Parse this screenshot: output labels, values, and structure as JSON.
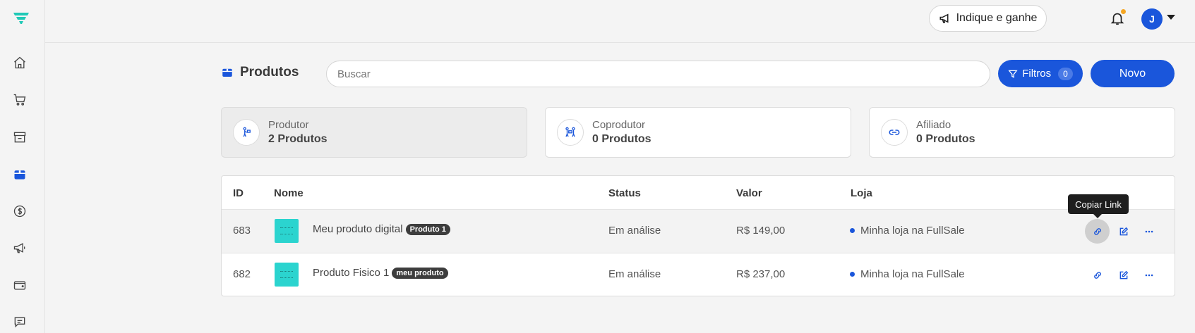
{
  "topbar": {
    "refer_label": "Indique e ganhe",
    "avatar_initial": "J"
  },
  "sidebar": {
    "items": [
      {
        "icon": "home-icon"
      },
      {
        "icon": "cart-icon"
      },
      {
        "icon": "store-icon"
      },
      {
        "icon": "box-icon",
        "active": true
      },
      {
        "icon": "dollar-icon"
      },
      {
        "icon": "megaphone-icon"
      },
      {
        "icon": "wallet-icon"
      },
      {
        "icon": "chat-icon"
      }
    ]
  },
  "header": {
    "title": "Produtos",
    "search_placeholder": "Buscar",
    "filter_label": "Filtros",
    "filter_count": "0",
    "new_label": "Novo"
  },
  "cards": [
    {
      "label": "Produtor",
      "count": "2 Produtos",
      "active": true
    },
    {
      "label": "Coprodutor",
      "count": "0 Produtos",
      "active": false
    },
    {
      "label": "Afiliado",
      "count": "0 Produtos",
      "active": false
    }
  ],
  "table": {
    "headers": {
      "id": "ID",
      "name": "Nome",
      "status": "Status",
      "value": "Valor",
      "store": "Loja"
    },
    "rows": [
      {
        "id": "683",
        "name": "Meu produto digital",
        "tag": "Produto 1",
        "status": "Em análise",
        "value": "R$ 149,00",
        "store": "Minha loja na FullSale"
      },
      {
        "id": "682",
        "name": "Produto Fisico 1",
        "tag": "meu produto",
        "status": "Em análise",
        "value": "R$ 237,00",
        "store": "Minha loja na FullSale"
      }
    ]
  },
  "tooltip": "Copiar Link",
  "colors": {
    "accent": "#1a56db",
    "notification_dot": "#f5a623",
    "thumbnail": "#2bd4cf"
  }
}
